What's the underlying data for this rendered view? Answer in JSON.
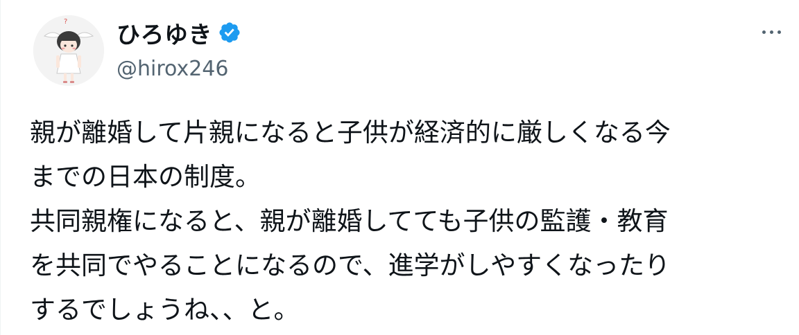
{
  "tweet": {
    "author": {
      "display_name": "ひろゆき",
      "handle": "@hirox246",
      "verified_icon": "verified-badge-icon",
      "avatar_icon": "avatar-illustration"
    },
    "more_icon": "more-options-icon",
    "lines": [
      "親が離婚して片親になると子供が経済的に厳しくなる今",
      "までの日本の制度。",
      "共同親権になると、親が離婚してても子供の監護・教育",
      "を共同でやることになるので、進学がしやすくなったり",
      "するでしょうね、、と。"
    ]
  },
  "colors": {
    "text_primary": "#0f1419",
    "text_secondary": "#536471",
    "verified_blue": "#1d9bf0",
    "background": "#ffffff"
  }
}
